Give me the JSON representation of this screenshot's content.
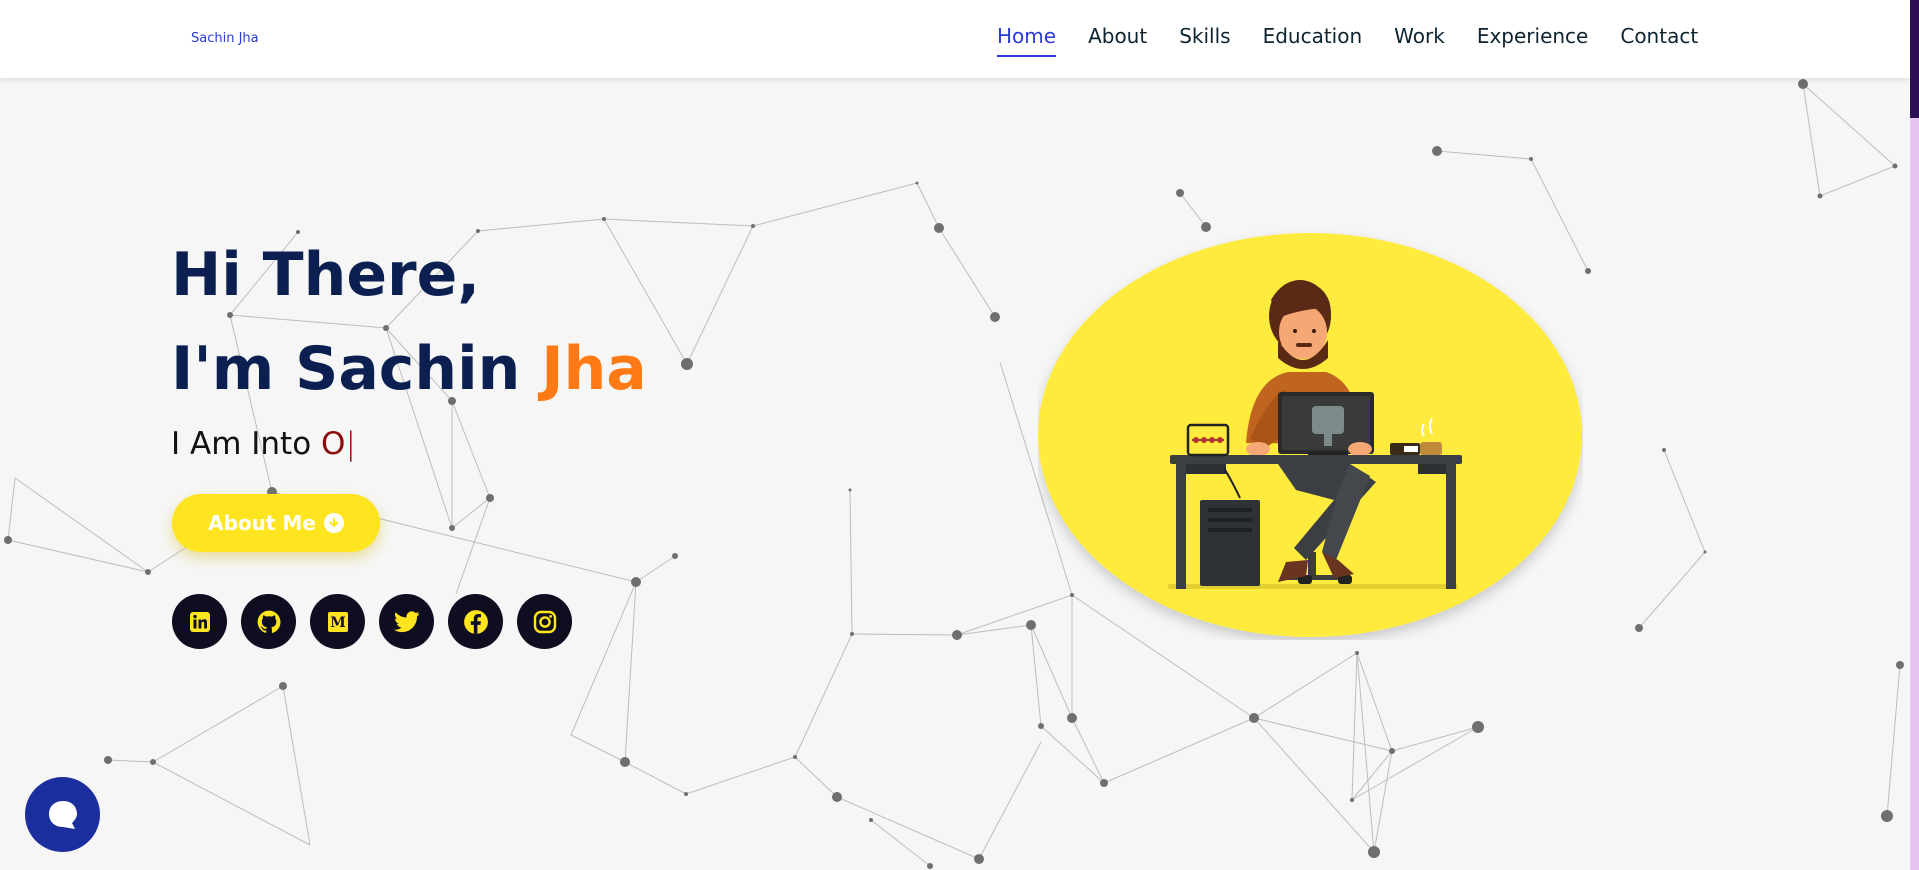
{
  "brand": "Sachin Jha",
  "nav": [
    {
      "label": "Home",
      "active": true
    },
    {
      "label": "About"
    },
    {
      "label": "Skills"
    },
    {
      "label": "Education"
    },
    {
      "label": "Work"
    },
    {
      "label": "Experience"
    },
    {
      "label": "Contact"
    }
  ],
  "hero": {
    "line1": "Hi There,",
    "line2_prefix": "I'm Sachin ",
    "line2_accent": "Jha",
    "typing_prefix": "I Am Into ",
    "typing_word": "O",
    "typing_cursor": "|",
    "button_label": "About Me"
  },
  "socials": [
    {
      "icon": "linkedin-icon",
      "glyph": "in"
    },
    {
      "icon": "github-icon"
    },
    {
      "icon": "medium-icon",
      "glyph": "M"
    },
    {
      "icon": "twitter-icon"
    },
    {
      "icon": "facebook-icon",
      "glyph": "f"
    },
    {
      "icon": "instagram-icon"
    }
  ],
  "colors": {
    "heading": "#0b2050",
    "accent_orange": "#ff7a15",
    "button_yellow": "#ffe51f",
    "nav_active": "#2a3bd6",
    "typing_word": "#8b0c0c",
    "chat_blue": "#1a2e9d"
  },
  "chat_icon": "chat-bubble-icon"
}
